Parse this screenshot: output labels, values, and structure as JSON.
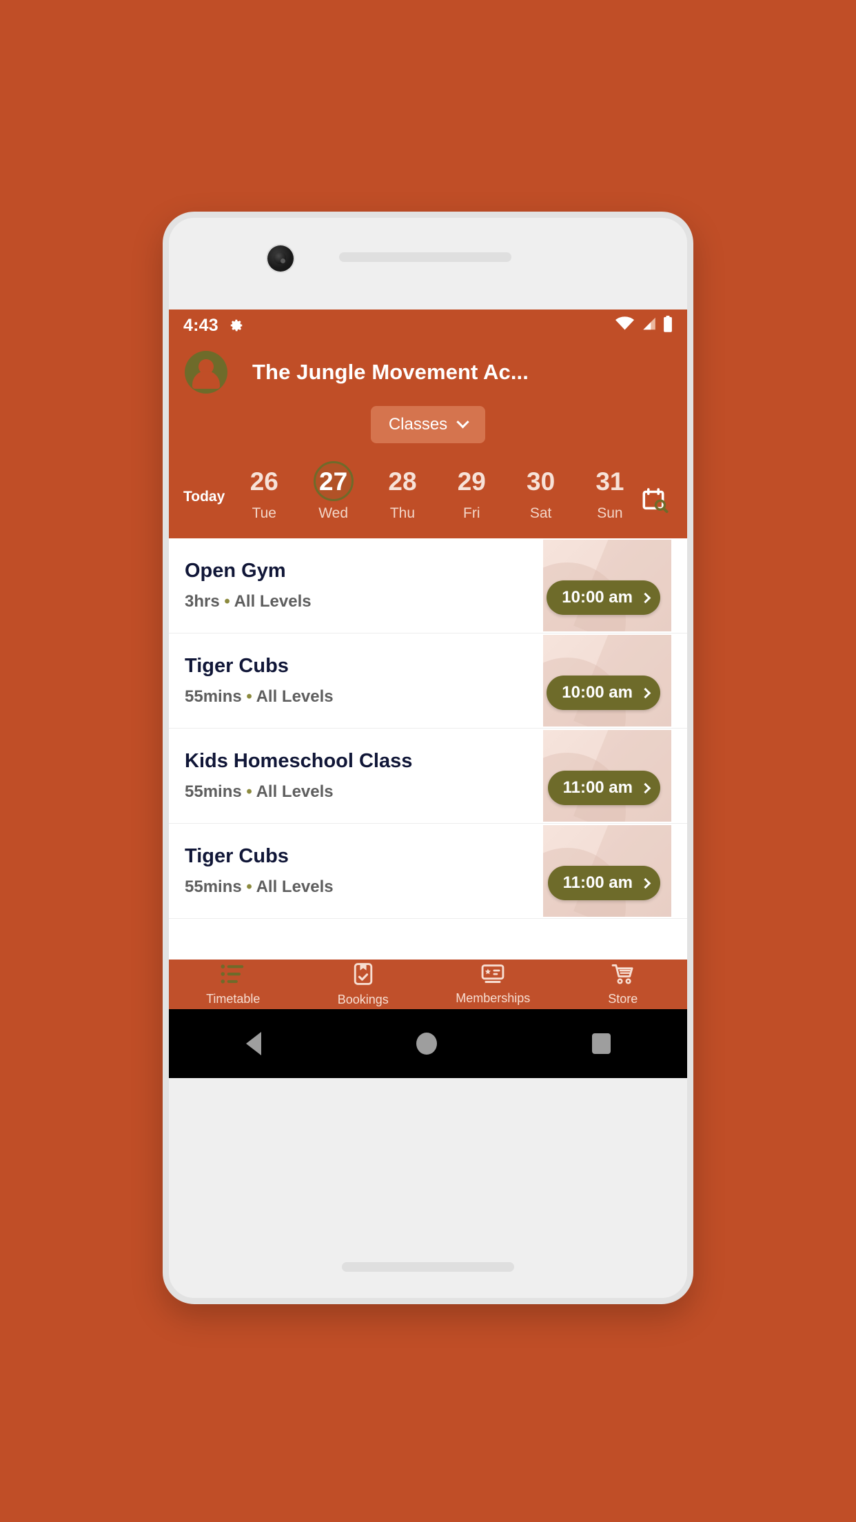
{
  "theme": {
    "background": "#C04E27",
    "accent_olive": "#6E6B2A",
    "chip_bg": "#D5744E",
    "thumb_bg": "#F3DED6",
    "title_color": "#101637"
  },
  "device": {
    "frame_name": "android-phone-mockup",
    "camera": "front-camera",
    "earpiece": "earpiece-speaker"
  },
  "statusbar": {
    "time": "4:43",
    "gear_icon": "gear-icon",
    "wifi_icon": "wifi-icon",
    "signal_icon": "cellular-signal-icon",
    "battery_icon": "battery-icon"
  },
  "header": {
    "avatar_icon": "account-avatar-icon",
    "title": "The Jungle Movement Ac...",
    "filter_chip": {
      "label": "Classes",
      "caret_icon": "chevron-down-icon"
    }
  },
  "datestrip": {
    "today_label": "Today",
    "calendar_search_icon": "calendar-search-icon",
    "days": [
      {
        "num": "26",
        "dow": "Tue",
        "selected": false
      },
      {
        "num": "27",
        "dow": "Wed",
        "selected": true
      },
      {
        "num": "28",
        "dow": "Thu",
        "selected": false
      },
      {
        "num": "29",
        "dow": "Fri",
        "selected": false
      },
      {
        "num": "30",
        "dow": "Sat",
        "selected": false
      },
      {
        "num": "31",
        "dow": "Sun",
        "selected": false
      }
    ]
  },
  "classes": [
    {
      "name": "Open Gym",
      "duration": "3hrs",
      "separator": "•",
      "level": "All Levels",
      "time": "10:00 am",
      "chevron_icon": "chevron-right-icon"
    },
    {
      "name": "Tiger Cubs",
      "duration": "55mins",
      "separator": "•",
      "level": "All Levels",
      "time": "10:00 am",
      "chevron_icon": "chevron-right-icon"
    },
    {
      "name": "Kids Homeschool Class",
      "duration": "55mins",
      "separator": "•",
      "level": "All Levels",
      "time": "11:00 am",
      "chevron_icon": "chevron-right-icon"
    },
    {
      "name": "Tiger Cubs",
      "duration": "55mins",
      "separator": "•",
      "level": "All Levels",
      "time": "11:00 am",
      "chevron_icon": "chevron-right-icon"
    }
  ],
  "bottomnav": {
    "items": [
      {
        "label": "Timetable",
        "icon": "timetable-list-icon",
        "active": true
      },
      {
        "label": "Bookings",
        "icon": "clipboard-check-icon",
        "active": false
      },
      {
        "label": "Memberships",
        "icon": "membership-card-icon",
        "active": false
      },
      {
        "label": "Store",
        "icon": "shopping-cart-icon",
        "active": false
      }
    ]
  },
  "androidnav": {
    "back_label": "back-button",
    "home_label": "home-button",
    "recents_label": "recents-button"
  }
}
